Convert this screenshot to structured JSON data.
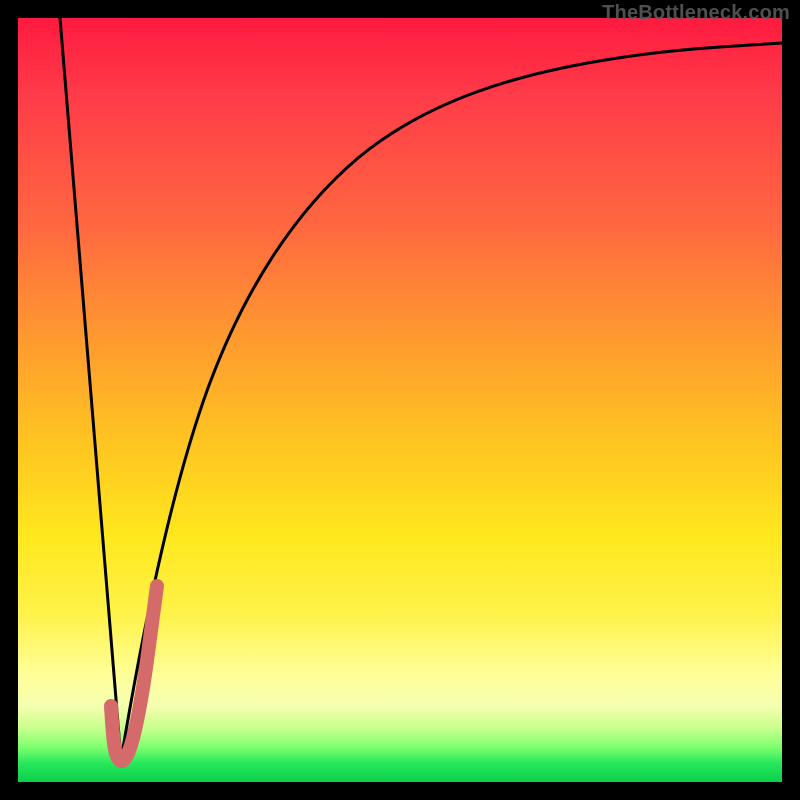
{
  "watermark": {
    "text": "TheBottleneck.com"
  },
  "colors": {
    "black_line": "#000000",
    "pink_mark": "#d46a6a",
    "gradient_top": "#ff1a3f",
    "gradient_bottom": "#0bd04b"
  },
  "chart_data": {
    "type": "line",
    "title": "",
    "xlabel": "",
    "ylabel": "",
    "xlim": [
      0,
      100
    ],
    "ylim": [
      0,
      100
    ],
    "grid": false,
    "series": [
      {
        "name": "left-descending-line",
        "x": [
          5.5,
          13.5
        ],
        "values": [
          100,
          3
        ]
      },
      {
        "name": "rising-curve",
        "x": [
          13.5,
          16,
          19,
          23,
          27,
          32,
          38,
          45,
          53,
          62,
          72,
          83,
          95,
          100
        ],
        "values": [
          3,
          16,
          30,
          44,
          55,
          64,
          72,
          78.5,
          83.5,
          87.5,
          90.5,
          93,
          95,
          95.7
        ]
      },
      {
        "name": "pink-j-mark",
        "x": [
          12.2,
          12.8,
          13.5,
          14.5,
          16.2,
          18.1
        ],
        "values": [
          10,
          5.5,
          3.2,
          5,
          15,
          26
        ]
      }
    ]
  }
}
